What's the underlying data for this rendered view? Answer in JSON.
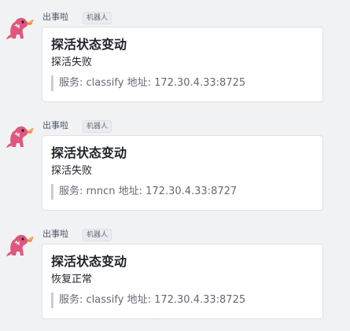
{
  "messages": [
    {
      "sender": "出事啦",
      "badge": "机器人",
      "avatar_icon": "dinosaur-bot-avatar-icon",
      "card": {
        "title": "探活状态变动",
        "status": "探活失败",
        "detail": "服务: classify 地址: 172.30.4.33:8725"
      }
    },
    {
      "sender": "出事啦",
      "badge": "机器人",
      "avatar_icon": "dinosaur-bot-avatar-icon",
      "card": {
        "title": "探活状态变动",
        "status": "探活失败",
        "detail": "服务: rnncn 地址: 172.30.4.33:8727"
      }
    },
    {
      "sender": "出事啦",
      "badge": "机器人",
      "avatar_icon": "dinosaur-bot-avatar-icon",
      "card": {
        "title": "探活状态变动",
        "status": "恢复正常",
        "detail": "服务: classify 地址: 172.30.4.33:8725"
      }
    }
  ],
  "colors": {
    "background": "#f1f2f4",
    "card_background": "#ffffff",
    "card_border": "#dee0e3",
    "avatar_pink": "#e0577d",
    "avatar_flame": "#f08a3c",
    "quote_bar": "#c9cdd4"
  }
}
